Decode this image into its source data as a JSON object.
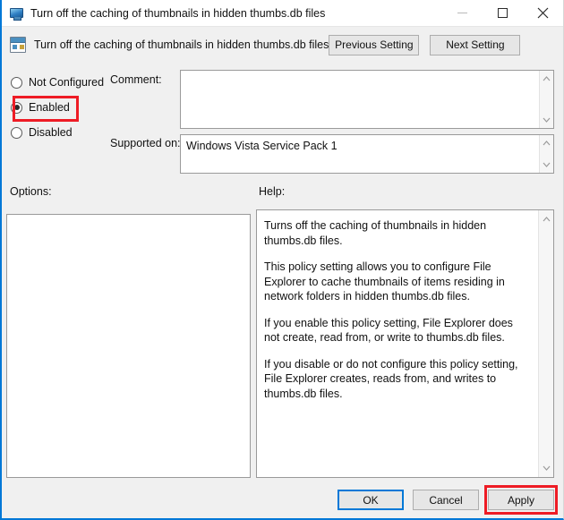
{
  "window": {
    "title": "Turn off the caching of thumbnails in hidden thumbs.db files",
    "title_icon": "computer-monitor-icon",
    "controls": {
      "minimize": "minimize-icon",
      "maximize": "maximize-icon",
      "close": "close-icon"
    }
  },
  "header": {
    "icon": "group-policy-setting-icon",
    "title": "Turn off the caching of thumbnails in hidden thumbs.db files",
    "previous_setting_label": "Previous Setting",
    "next_setting_label": "Next Setting"
  },
  "state_options": {
    "items": [
      {
        "label": "Not Configured",
        "selected": false
      },
      {
        "label": "Enabled",
        "selected": true
      },
      {
        "label": "Disabled",
        "selected": false
      }
    ],
    "highlighted": "Enabled"
  },
  "fields": {
    "comment_label": "Comment:",
    "comment_value": "",
    "supported_label": "Supported on:",
    "supported_value": "Windows Vista Service Pack 1"
  },
  "sections": {
    "options_label": "Options:",
    "options_content": "",
    "help_label": "Help:",
    "help_paragraphs": [
      "Turns off the caching of thumbnails in hidden thumbs.db files.",
      "This policy setting allows you to configure File Explorer to cache thumbnails of items residing in network folders in hidden thumbs.db files.",
      "If you enable this policy setting, File Explorer does not create, read from, or write to thumbs.db files.",
      "If you disable or do not configure this policy setting, File Explorer creates, reads from, and writes to thumbs.db files."
    ]
  },
  "footer": {
    "ok_label": "OK",
    "cancel_label": "Cancel",
    "apply_label": "Apply",
    "highlighted": "Apply"
  },
  "colors": {
    "accent": "#0078d7",
    "highlight_box": "#ee1c25",
    "window_background": "#f0f0f0",
    "field_background": "#ffffff",
    "button_face": "#e6e6e6"
  }
}
